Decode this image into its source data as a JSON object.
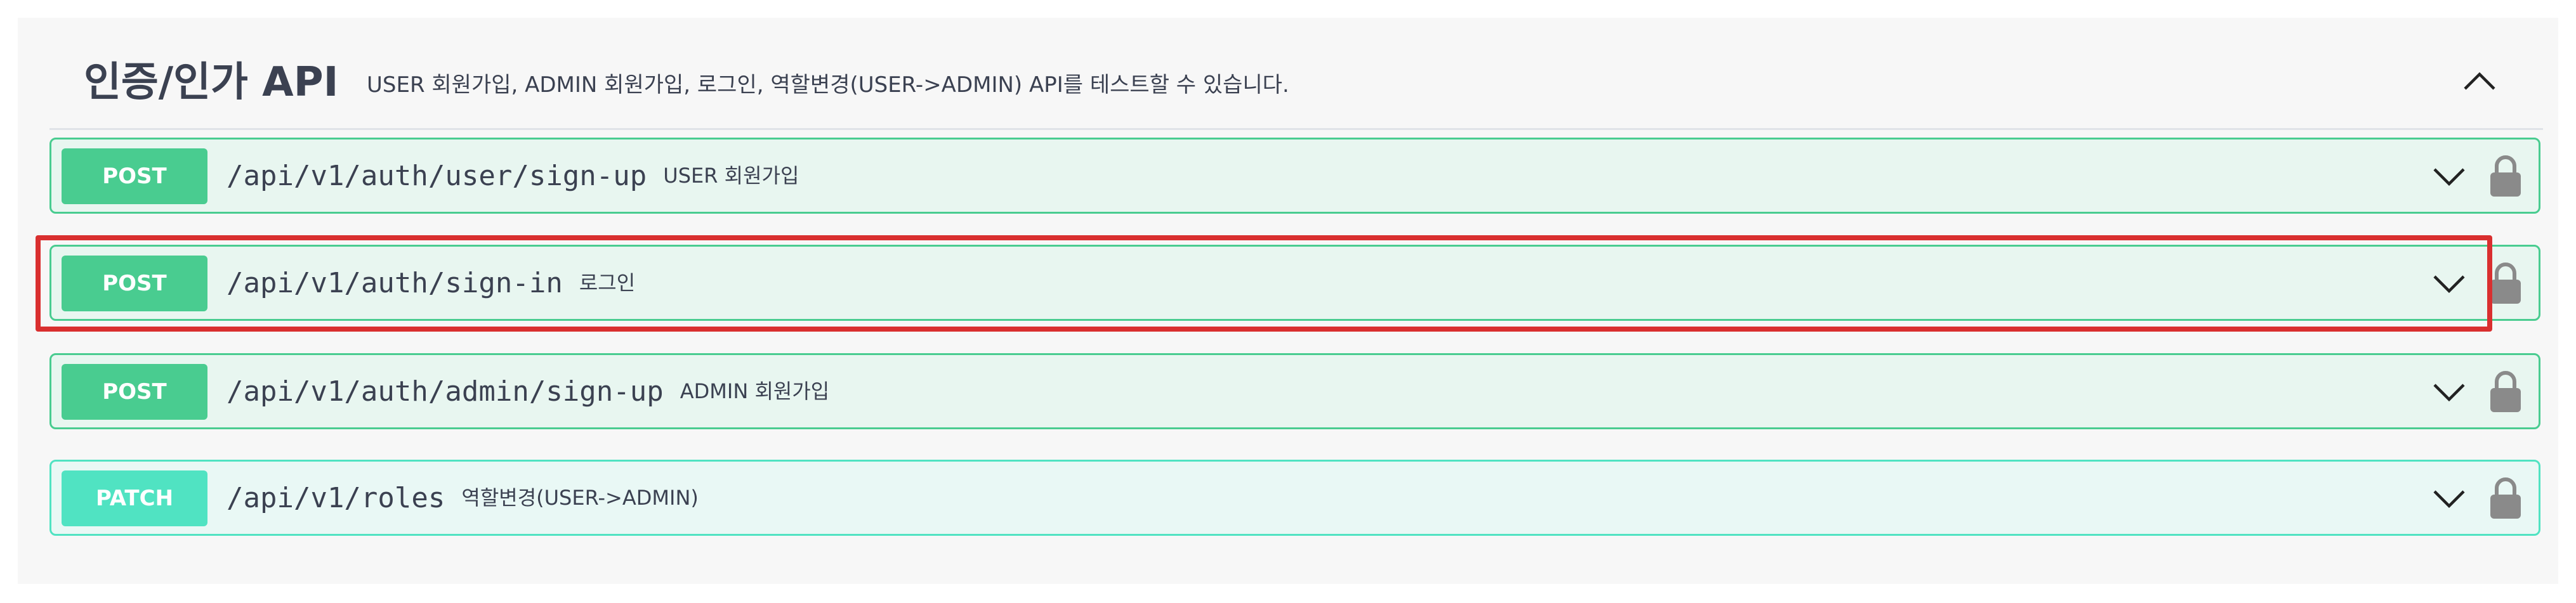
{
  "section": {
    "title": "인증/인가 API",
    "description": "USER 회원가입, ADMIN 회원가입, 로그인, 역할변경(USER->ADMIN) API를 테스트할 수 있습니다.",
    "collapse_icon": "chevron-up-icon"
  },
  "operations": [
    {
      "method": "POST",
      "path": "/api/v1/auth/user/sign-up",
      "summary": "USER 회원가입",
      "color": "#49cc90"
    },
    {
      "method": "POST",
      "path": "/api/v1/auth/sign-in",
      "summary": "로그인",
      "color": "#49cc90",
      "highlighted": true
    },
    {
      "method": "POST",
      "path": "/api/v1/auth/admin/sign-up",
      "summary": "ADMIN 회원가입",
      "color": "#49cc90"
    },
    {
      "method": "PATCH",
      "path": "/api/v1/roles",
      "summary": "역할변경(USER->ADMIN)",
      "color": "#50e3c2"
    }
  ],
  "icons": {
    "expand": "chevron-down-icon",
    "lock": "lock-icon"
  },
  "colors": {
    "highlight": "#d92f2f"
  }
}
